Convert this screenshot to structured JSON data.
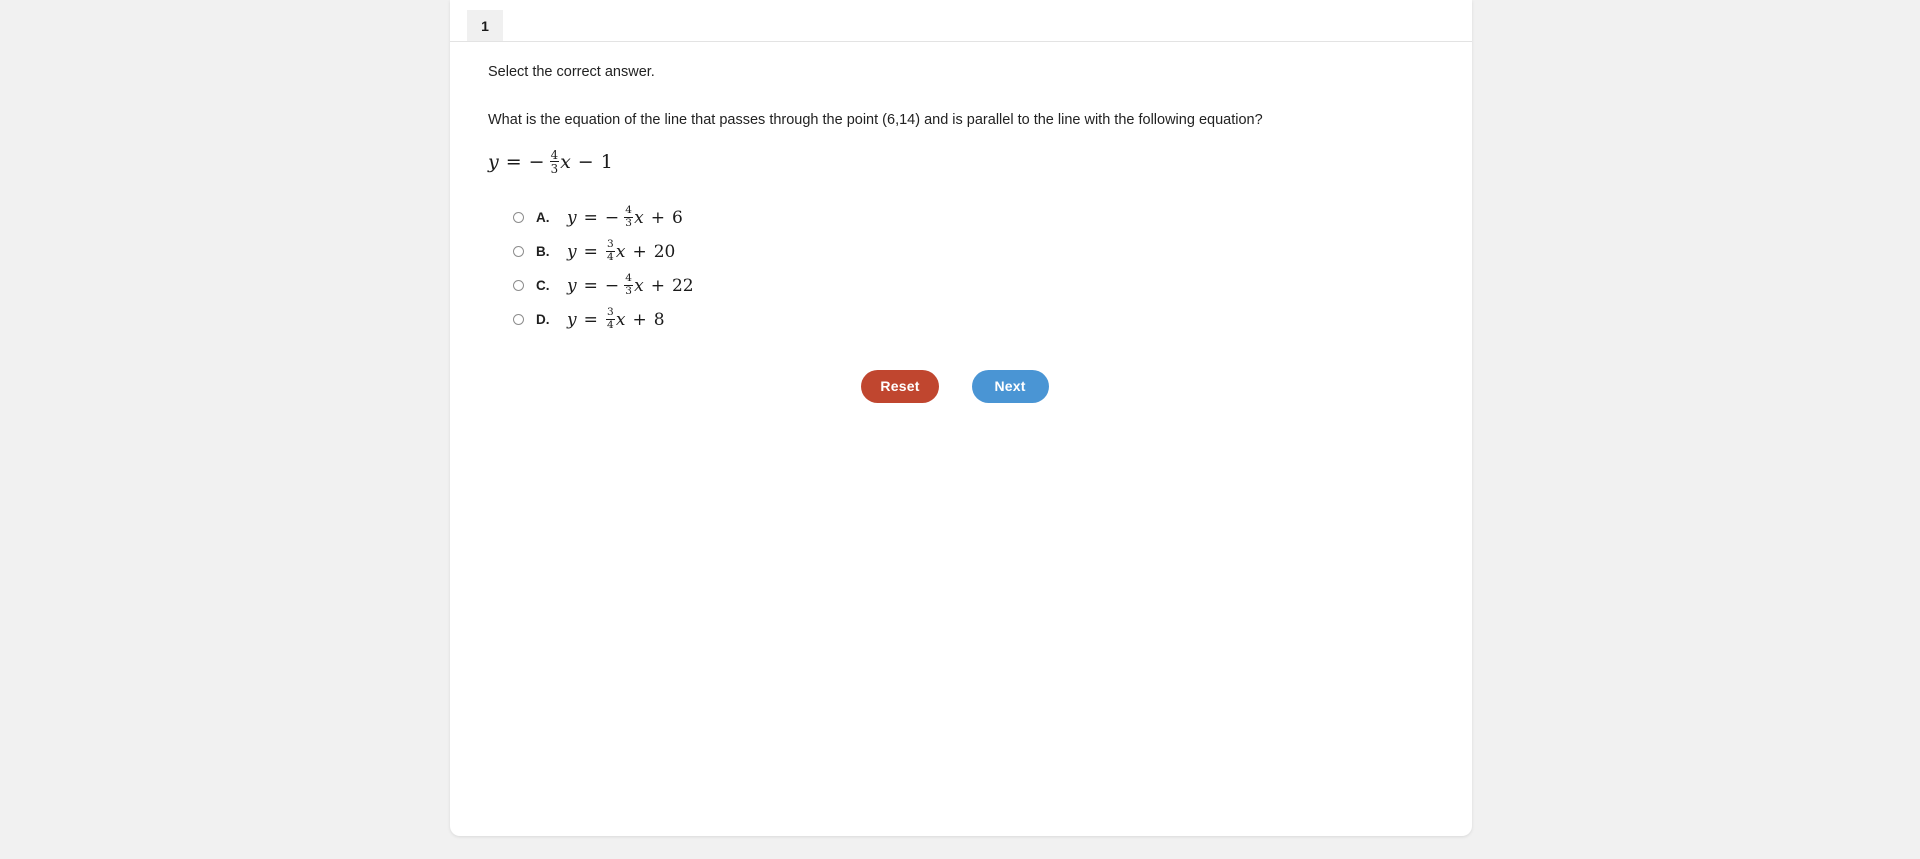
{
  "tab": {
    "label": "1"
  },
  "content": {
    "prompt": "Select the correct answer.",
    "question": "What is the equation of the line that passes through the point (6,14) and is parallel to the line with the following equation?",
    "stem_equation": {
      "lhs": "y",
      "equals": "=",
      "sign": "−",
      "frac_num": "4",
      "frac_den": "3",
      "variable": "x",
      "operator": "−",
      "constant": "1",
      "plain": "y = − 4/3 x − 1"
    }
  },
  "options": [
    {
      "letter": "A.",
      "selected": false,
      "equation": {
        "lhs": "y",
        "equals": "=",
        "sign": "−",
        "frac_num": "4",
        "frac_den": "3",
        "variable": "x",
        "operator": "+",
        "constant": "6",
        "plain": "y = − 4/3 x + 6"
      }
    },
    {
      "letter": "B.",
      "selected": false,
      "equation": {
        "lhs": "y",
        "equals": "=",
        "sign": "",
        "frac_num": "3",
        "frac_den": "4",
        "variable": "x",
        "operator": "+",
        "constant": "20",
        "plain": "y = 3/4 x + 20"
      }
    },
    {
      "letter": "C.",
      "selected": false,
      "equation": {
        "lhs": "y",
        "equals": "=",
        "sign": "−",
        "frac_num": "4",
        "frac_den": "3",
        "variable": "x",
        "operator": "+",
        "constant": "22",
        "plain": "y = − 4/3 x + 22"
      }
    },
    {
      "letter": "D.",
      "selected": false,
      "equation": {
        "lhs": "y",
        "equals": "=",
        "sign": "",
        "frac_num": "3",
        "frac_den": "4",
        "variable": "x",
        "operator": "+",
        "constant": "8",
        "plain": "y = 3/4 x + 8"
      }
    }
  ],
  "buttons": {
    "reset_label": "Reset",
    "next_label": "Next"
  },
  "colors": {
    "page_background": "#f1f1f1",
    "card_background": "#ffffff",
    "tab_background": "#f0f0f0",
    "reset_button": "#c0462f",
    "next_button": "#4a95d4",
    "text": "#222222",
    "radio_border": "#8d8d8d"
  }
}
